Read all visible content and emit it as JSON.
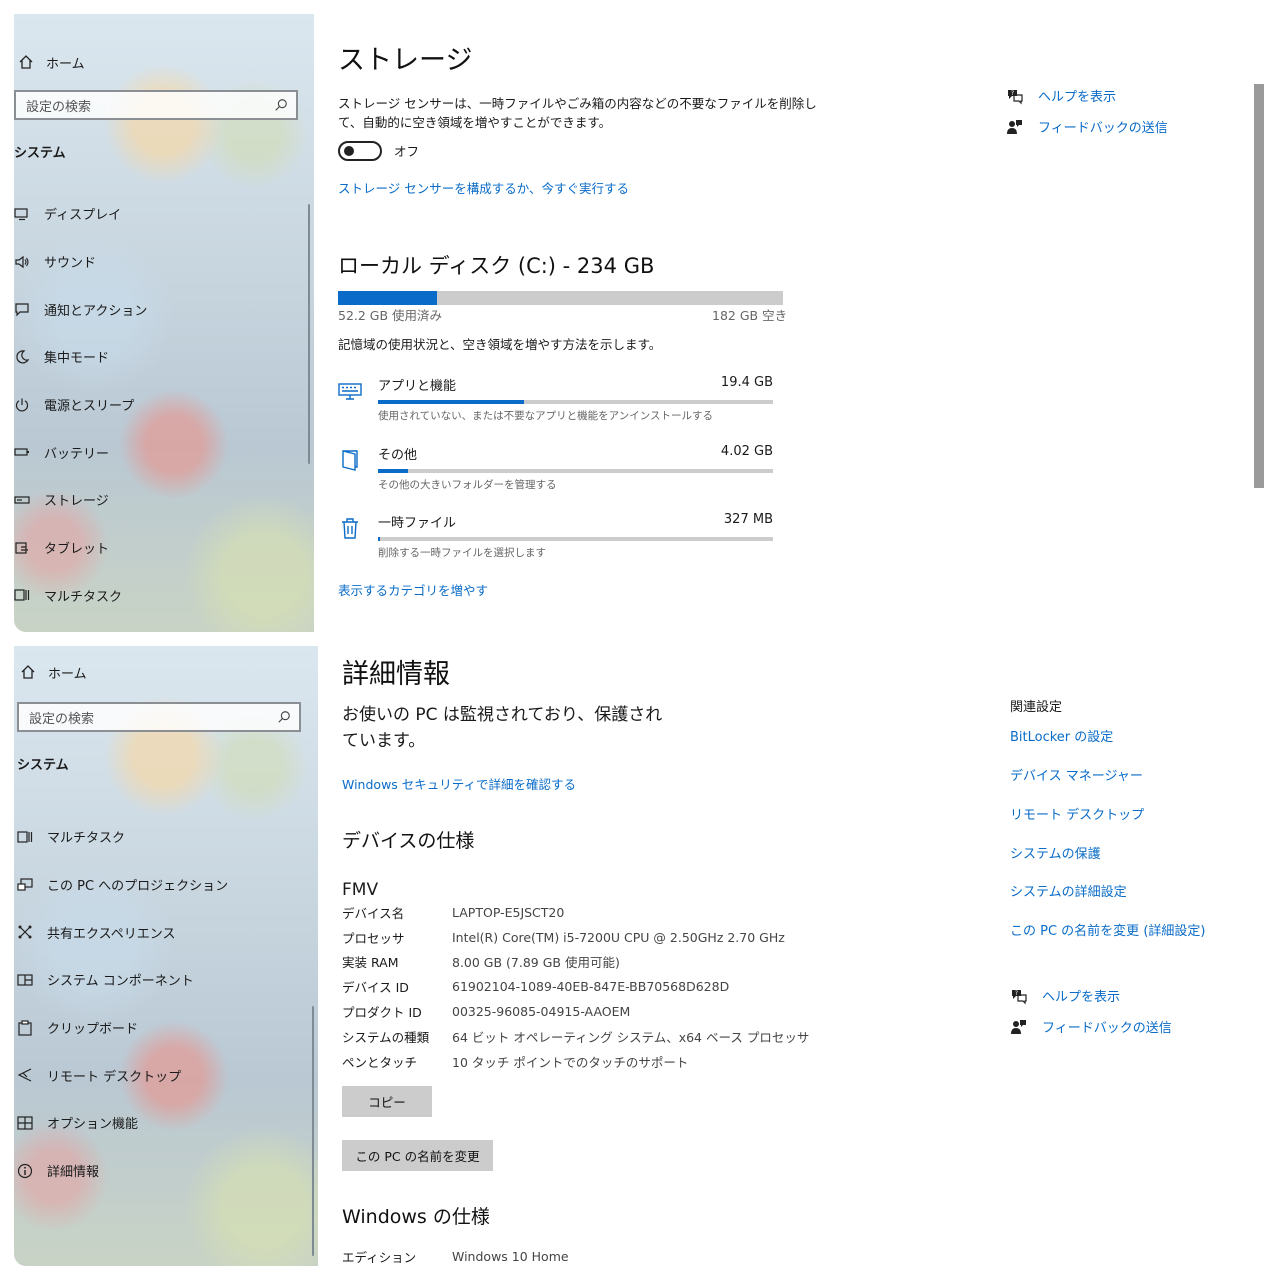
{
  "common": {
    "home": "ホーム",
    "search_placeholder": "設定の検索",
    "section": "システム",
    "help": "ヘルプを表示",
    "feedback": "フィードバックの送信"
  },
  "top": {
    "nav": [
      {
        "icon": "display-icon",
        "label": "ディスプレイ"
      },
      {
        "icon": "sound-icon",
        "label": "サウンド"
      },
      {
        "icon": "notification-icon",
        "label": "通知とアクション"
      },
      {
        "icon": "focus-icon",
        "label": "集中モード"
      },
      {
        "icon": "power-icon",
        "label": "電源とスリープ"
      },
      {
        "icon": "battery-icon",
        "label": "バッテリー"
      },
      {
        "icon": "storage-icon",
        "label": "ストレージ"
      },
      {
        "icon": "tablet-icon",
        "label": "タブレット"
      },
      {
        "icon": "multitask-icon",
        "label": "マルチタスク"
      }
    ],
    "title": "ストレージ",
    "sense_desc_1": "ストレージ センサーは、一時ファイルやごみ箱の内容などの不要なファイルを削除し",
    "sense_desc_2": "て、自動的に空き領域を増やすことができます。",
    "toggle_state": "オフ",
    "configure_link": "ストレージ センサーを構成するか、今すぐ実行する",
    "disk_title": "ローカル ディスク (C:) - 234 GB",
    "disk_used_fraction": 0.223,
    "used_label": "52.2 GB 使用済み",
    "free_label": "182 GB 空き",
    "usage_desc": "記憶域の使用状況と、空き領域を増やす方法を示します。",
    "categories": [
      {
        "icon": "keyboard-icon",
        "name": "アプリと機能",
        "size": "19.4 GB",
        "fraction": 0.37,
        "desc": "使用されていない、または不要なアプリと機能をアンインストールする"
      },
      {
        "icon": "folder-icon",
        "name": "その他",
        "size": "4.02 GB",
        "fraction": 0.077,
        "desc": "その他の大きいフォルダーを管理する"
      },
      {
        "icon": "trash-icon",
        "name": "一時ファイル",
        "size": "327 MB",
        "fraction": 0.006,
        "desc": "削除する一時ファイルを選択します"
      }
    ],
    "more_link": "表示するカテゴリを増やす"
  },
  "bottom": {
    "nav": [
      {
        "icon": "multitask-icon",
        "label": "マルチタスク"
      },
      {
        "icon": "projection-icon",
        "label": "この PC へのプロジェクション"
      },
      {
        "icon": "shared-icon",
        "label": "共有エクスペリエンス"
      },
      {
        "icon": "components-icon",
        "label": "システム コンポーネント"
      },
      {
        "icon": "clipboard-icon",
        "label": "クリップボード"
      },
      {
        "icon": "remote-icon",
        "label": "リモート デスクトップ"
      },
      {
        "icon": "optional-icon",
        "label": "オプション機能"
      },
      {
        "icon": "info-icon",
        "label": "詳細情報"
      }
    ],
    "title": "詳細情報",
    "protect_1": "お使いの PC は監視されており、保護され",
    "protect_2": "ています。",
    "security_link": "Windows セキュリティで詳細を確認する",
    "device_spec_title": "デバイスの仕様",
    "model": "FMV",
    "specs": [
      {
        "key": "デバイス名",
        "value": "LAPTOP-E5JSCT20"
      },
      {
        "key": "プロセッサ",
        "value": "Intel(R) Core(TM) i5-7200U CPU @ 2.50GHz   2.70 GHz"
      },
      {
        "key": "実装 RAM",
        "value": "8.00 GB (7.89 GB 使用可能)"
      },
      {
        "key": "デバイス ID",
        "value": "61902104-1089-40EB-847E-BB70568D628D"
      },
      {
        "key": "プロダクト ID",
        "value": "00325-96085-04915-AAOEM"
      },
      {
        "key": "システムの種類",
        "value": "64 ビット オペレーティング システム、x64 ベース プロセッサ"
      },
      {
        "key": "ペンとタッチ",
        "value": "10 タッチ ポイントでのタッチのサポート"
      }
    ],
    "copy_button": "コピー",
    "rename_button": "この PC の名前を変更",
    "windows_spec_title": "Windows の仕様",
    "edition_key": "エディション",
    "edition_value": "Windows 10 Home",
    "related_title": "関連設定",
    "related_links": [
      "BitLocker の設定",
      "デバイス マネージャー",
      "リモート デスクトップ",
      "システムの保護",
      "システムの詳細設定",
      "この PC の名前を変更 (詳細設定)"
    ]
  },
  "colors": {
    "accent": "#0a6cc8",
    "bar_track": "#cccccc",
    "button": "#cccccc"
  }
}
